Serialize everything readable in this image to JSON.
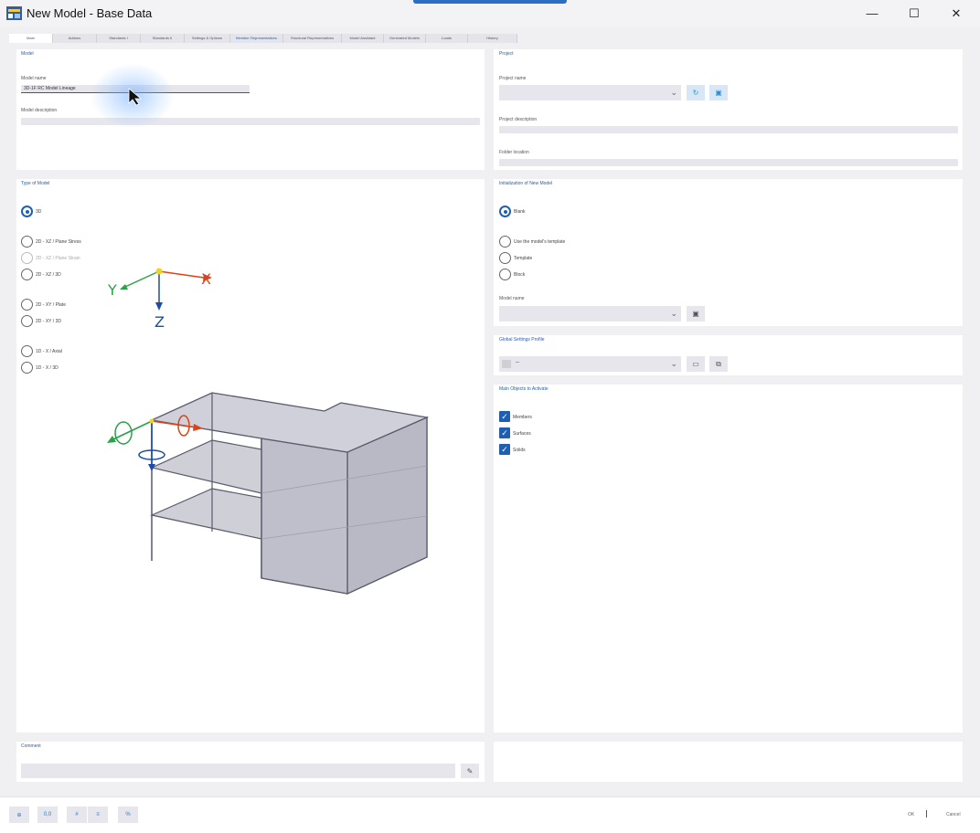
{
  "window": {
    "title": "New Model - Base Data",
    "minimize_glyph": "—",
    "maximize_glyph": "☐",
    "close_glyph": "✕",
    "accent_color": "#1f5fb0"
  },
  "tabs": [
    {
      "label": "Main",
      "active": true
    },
    {
      "label": "Addons"
    },
    {
      "label": "Standards I"
    },
    {
      "label": "Standards II"
    },
    {
      "label": "Settings & Options"
    },
    {
      "label": "Member Representatives"
    },
    {
      "label": "Structural Representatives"
    },
    {
      "label": "Model Assistant"
    },
    {
      "label": "Generated Models"
    },
    {
      "label": "Loads"
    },
    {
      "label": "History"
    }
  ],
  "model": {
    "header": "Model",
    "name_label": "Model name",
    "name_value": "3D-1F RC Model Lineage",
    "description_label": "Model description",
    "description_value": ""
  },
  "project": {
    "header": "Project",
    "name_label": "Project name",
    "description_label": "Project description",
    "folder_label": "Folder location",
    "new_project_icon": "new-folder-icon",
    "browse_icon": "browse-icon"
  },
  "type_of_model": {
    "header": "Type of Model",
    "options": [
      {
        "label": "3D",
        "selected": true,
        "enabled": true
      },
      {
        "label": "2D - XZ / Plane Stress",
        "selected": false,
        "enabled": true
      },
      {
        "label": "2D - XZ / Plane Strain",
        "selected": false,
        "enabled": false
      },
      {
        "label": "2D - XZ / 3D",
        "selected": false,
        "enabled": true
      },
      {
        "label": "2D - XY / Plate",
        "selected": false,
        "enabled": true
      },
      {
        "label": "2D - XY / 3D",
        "selected": false,
        "enabled": true
      },
      {
        "label": "1D - X / Axial",
        "selected": false,
        "enabled": true
      },
      {
        "label": "1D - X / 3D",
        "selected": false,
        "enabled": true
      }
    ],
    "axis_labels": {
      "x": "X",
      "y": "Y",
      "z": "Z"
    },
    "axis_colors": {
      "x": "#d8451b",
      "y": "#2aa24a",
      "z": "#1c4ca8"
    }
  },
  "initialization": {
    "header": "Initialization of New Model",
    "options": [
      {
        "label": "Blank",
        "selected": true
      },
      {
        "label": "Use the model's template",
        "selected": false
      },
      {
        "label": "Template",
        "selected": false
      },
      {
        "label": "Block",
        "selected": false
      }
    ],
    "model_name_label": "Model name",
    "model_name_value": ""
  },
  "global_settings": {
    "header": "Global Settings Profile",
    "selected_value": "--"
  },
  "object_types": {
    "header": "Main Objects to Activate",
    "items": [
      {
        "label": "Members",
        "checked": true
      },
      {
        "label": "Surfaces",
        "checked": true
      },
      {
        "label": "Solids",
        "checked": true
      }
    ]
  },
  "comment": {
    "header": "Comment",
    "value": ""
  },
  "statusbar": {
    "buttons": [
      {
        "glyph": "⊕",
        "icon": "search-icon"
      },
      {
        "glyph": "0,0",
        "icon": "units-icon"
      },
      {
        "glyph": "#",
        "icon": "numbering-icon"
      },
      {
        "glyph": "≡",
        "icon": "list-icon"
      },
      {
        "glyph": "%",
        "icon": "percent-icon"
      }
    ],
    "ok_label": "OK",
    "cancel_label": "Cancel"
  }
}
